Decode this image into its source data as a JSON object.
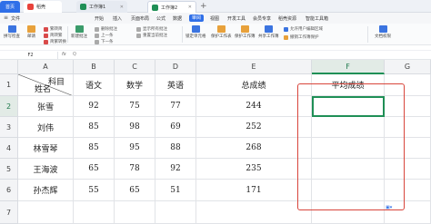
{
  "titlebar": {
    "tabs": [
      {
        "label": "首页",
        "kind": "home"
      },
      {
        "label": "稻壳",
        "kind": "doc",
        "color": "#e8423b"
      },
      {
        "label": "工作簿1",
        "kind": "sheet",
        "color": "#1f8f56"
      },
      {
        "label": "工作簿2",
        "kind": "sheet",
        "color": "#1f8f56"
      }
    ],
    "new_tab": "+"
  },
  "menu": {
    "items": [
      "文件",
      "开始",
      "插入",
      "页面布局",
      "公式",
      "数据",
      "审阅",
      "视图",
      "开发工具",
      "会员专享",
      "稻壳资源",
      "智能工具箱"
    ],
    "active": "审阅"
  },
  "ribbon": {
    "buttons": [
      {
        "label": "拼写检查",
        "icon": "spellcheck-icon",
        "color": "#3b74e0"
      },
      {
        "label": "邮请",
        "icon": "mail-icon",
        "color": "#e8a13b"
      },
      {
        "label": "简转繁",
        "icon": "convert-icon",
        "color": "#d94a4a"
      },
      {
        "label": "新建批注",
        "icon": "comment-icon",
        "color": "#3b9c6b"
      },
      {
        "label": "锁定单元格",
        "icon": "lock-icon",
        "color": "#3b74e0"
      },
      {
        "label": "保护工作表",
        "icon": "protect-sheet-icon",
        "color": "#e8a13b"
      },
      {
        "label": "保护工作簿",
        "icon": "protect-book-icon",
        "color": "#e8a13b"
      },
      {
        "label": "共享工作簿",
        "icon": "share-icon",
        "color": "#3b74e0"
      },
      {
        "label": "文档权限",
        "icon": "permission-icon",
        "color": "#3b74e0"
      }
    ],
    "small": [
      "繁转简",
      "简繁转换",
      "删除批注",
      "上一条",
      "下一条",
      "显示所有批注",
      "重置当前批注",
      "允许用户编辑区域",
      "撤销工作簿保护"
    ]
  },
  "formula_bar": {
    "name_box": "F2",
    "fx": "fx",
    "q": "Q"
  },
  "sheet": {
    "columns": [
      "A",
      "B",
      "C",
      "D",
      "E",
      "F",
      "G"
    ],
    "rows": [
      "1",
      "2",
      "3",
      "4",
      "5",
      "6",
      "7"
    ],
    "selected_column": "F",
    "selected_row": "2",
    "header": {
      "a_top": "科目",
      "a_bottom": "姓名",
      "b": "语文",
      "c": "数学",
      "d": "英语",
      "e": "总成绩",
      "f": "平均成绩"
    },
    "data": [
      {
        "name": "张雪",
        "chinese": "92",
        "math": "75",
        "english": "77",
        "total": "244"
      },
      {
        "name": "刘伟",
        "chinese": "85",
        "math": "98",
        "english": "69",
        "total": "252"
      },
      {
        "name": "林雪琴",
        "chinese": "85",
        "math": "95",
        "english": "88",
        "total": "268"
      },
      {
        "name": "王海波",
        "chinese": "65",
        "math": "78",
        "english": "92",
        "total": "235"
      },
      {
        "name": "孙杰辉",
        "chinese": "55",
        "math": "65",
        "english": "51",
        "total": "171"
      }
    ]
  },
  "colors": {
    "accent": "#2f6fe8",
    "selection": "#1f8f56",
    "highlight": "#d8453b"
  }
}
